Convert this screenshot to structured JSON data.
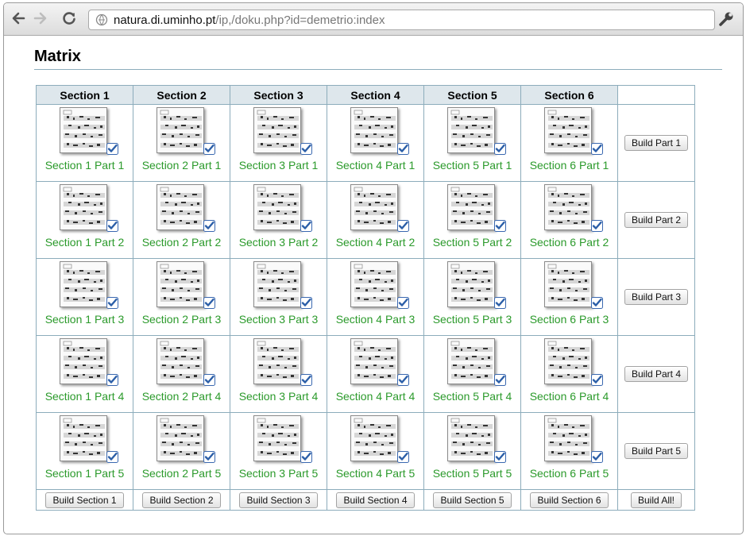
{
  "browser": {
    "url_host": "natura.di.uminho.pt",
    "url_path": "/ip,/doku.php?id=demetrio:index"
  },
  "page": {
    "title": "Matrix"
  },
  "matrix": {
    "headers": [
      "Section 1",
      "Section 2",
      "Section 3",
      "Section 4",
      "Section 5",
      "Section 6"
    ],
    "rows": [
      {
        "cells": [
          "Section 1 Part 1",
          "Section 2 Part 1",
          "Section 3 Part 1",
          "Section 4 Part 1",
          "Section 5 Part 1",
          "Section 6 Part 1"
        ],
        "build_label": "Build Part 1"
      },
      {
        "cells": [
          "Section 1 Part 2",
          "Section 2 Part 2",
          "Section 3 Part 2",
          "Section 4 Part 2",
          "Section 5 Part 2",
          "Section 6 Part 2"
        ],
        "build_label": "Build Part 2"
      },
      {
        "cells": [
          "Section 1 Part 3",
          "Section 2 Part 3",
          "Section 3 Part 3",
          "Section 4 Part 3",
          "Section 5 Part 3",
          "Section 6 Part 3"
        ],
        "build_label": "Build Part 3"
      },
      {
        "cells": [
          "Section 1 Part 4",
          "Section 2 Part 4",
          "Section 3 Part 4",
          "Section 4 Part 4",
          "Section 5 Part 4",
          "Section 6 Part 4"
        ],
        "build_label": "Build Part 4"
      },
      {
        "cells": [
          "Section 1 Part 5",
          "Section 2 Part 5",
          "Section 3 Part 5",
          "Section 4 Part 5",
          "Section 5 Part 5",
          "Section 6 Part 5"
        ],
        "build_label": "Build Part 5"
      }
    ],
    "footer": [
      "Build Section 1",
      "Build Section 2",
      "Build Section 3",
      "Build Section 4",
      "Build Section 5",
      "Build Section 6"
    ],
    "build_all_label": "Build All!"
  },
  "icons": {
    "back": "back-arrow-icon",
    "forward": "forward-arrow-icon",
    "reload": "reload-icon",
    "site": "page-info-icon",
    "menu": "wrench-icon",
    "thumbnail": "sheet-music-thumbnail",
    "status": "checkbox-checked-icon"
  },
  "colors": {
    "link": "#2b9a2b",
    "header_bg": "#dee7ec",
    "border": "#8cacbb",
    "check": "#2c5fa8"
  }
}
